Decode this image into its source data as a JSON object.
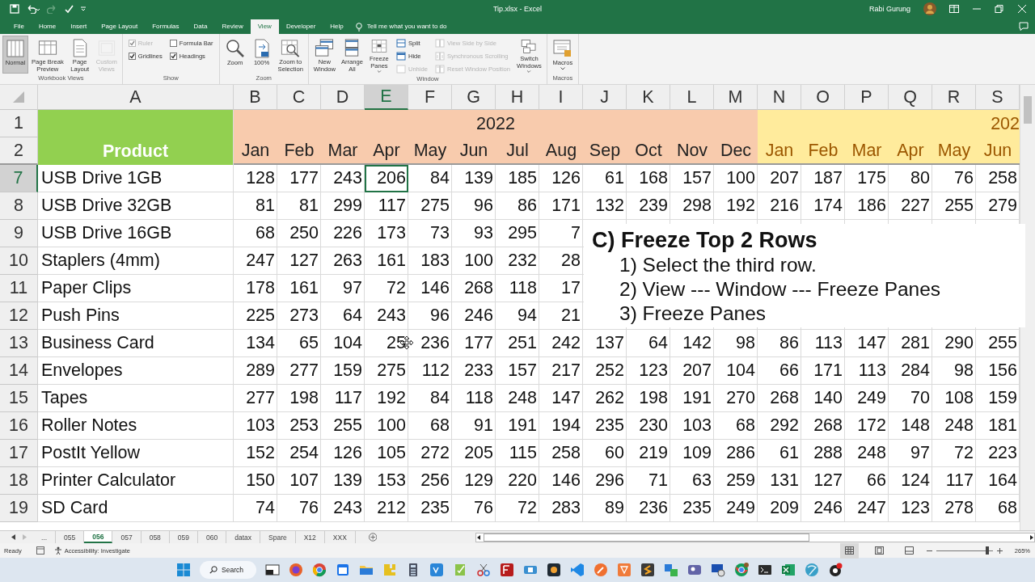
{
  "title_bar": {
    "title": "Tip.xlsx  -  Excel",
    "user": "Rabi Gurung"
  },
  "ribbon_tabs": [
    {
      "label": "File",
      "selected": false
    },
    {
      "label": "Home",
      "selected": false
    },
    {
      "label": "Insert",
      "selected": false
    },
    {
      "label": "Page Layout",
      "selected": false
    },
    {
      "label": "Formulas",
      "selected": false
    },
    {
      "label": "Data",
      "selected": false
    },
    {
      "label": "Review",
      "selected": false
    },
    {
      "label": "View",
      "selected": true
    },
    {
      "label": "Developer",
      "selected": false
    },
    {
      "label": "Help",
      "selected": false
    }
  ],
  "tell_me": "Tell me what you want to do",
  "ribbon_groups": [
    {
      "name": "Workbook Views",
      "items": [
        {
          "kind": "large",
          "label": "Normal",
          "selected": true,
          "disabled": false
        },
        {
          "kind": "large",
          "label": "Page Break\nPreview",
          "selected": false,
          "disabled": false
        },
        {
          "kind": "large",
          "label": "Page\nLayout",
          "selected": false,
          "disabled": false
        },
        {
          "kind": "large",
          "label": "Custom\nViews",
          "selected": false,
          "disabled": true
        }
      ]
    },
    {
      "name": "Show",
      "items": [
        {
          "kind": "stack",
          "items": [
            {
              "kind": "check",
              "label": "Ruler",
              "checked": true,
              "disabled": true
            },
            {
              "kind": "check",
              "label": "Gridlines",
              "checked": true,
              "disabled": false
            }
          ]
        },
        {
          "kind": "stack",
          "items": [
            {
              "kind": "check",
              "label": "Formula Bar",
              "checked": false,
              "disabled": false
            },
            {
              "kind": "check",
              "label": "Headings",
              "checked": true,
              "disabled": false
            }
          ]
        }
      ]
    },
    {
      "name": "Zoom",
      "items": [
        {
          "kind": "large",
          "label": "Zoom",
          "disabled": false
        },
        {
          "kind": "large",
          "label": "100%",
          "disabled": false
        },
        {
          "kind": "large",
          "label": "Zoom to\nSelection",
          "disabled": false
        }
      ]
    },
    {
      "name": "Window",
      "items": [
        {
          "kind": "large",
          "label": "New\nWindow",
          "disabled": false
        },
        {
          "kind": "large",
          "label": "Arrange\nAll",
          "disabled": false
        },
        {
          "kind": "large",
          "label": "Freeze\nPanes",
          "dropdown": true,
          "disabled": false
        },
        {
          "kind": "stack",
          "items": [
            {
              "kind": "small",
              "label": "Split",
              "disabled": false
            },
            {
              "kind": "small",
              "label": "Hide",
              "disabled": false
            },
            {
              "kind": "small",
              "label": "Unhide",
              "disabled": true
            }
          ]
        },
        {
          "kind": "stack",
          "items": [
            {
              "kind": "small",
              "label": "View Side by Side",
              "disabled": true
            },
            {
              "kind": "small",
              "label": "Synchronous Scrolling",
              "disabled": true
            },
            {
              "kind": "small",
              "label": "Reset Window Position",
              "disabled": true
            }
          ]
        },
        {
          "kind": "large",
          "label": "Switch\nWindows",
          "dropdown": true,
          "disabled": false
        }
      ]
    },
    {
      "name": "Macros",
      "items": [
        {
          "kind": "large",
          "label": "Macros",
          "dropdown": true,
          "disabled": false
        }
      ]
    }
  ],
  "sheet": {
    "columns": [
      {
        "label": "A",
        "selected": false
      },
      {
        "label": "B",
        "selected": false
      },
      {
        "label": "C",
        "selected": false
      },
      {
        "label": "D",
        "selected": false
      },
      {
        "label": "E",
        "selected": true
      },
      {
        "label": "F",
        "selected": false
      },
      {
        "label": "G",
        "selected": false
      },
      {
        "label": "H",
        "selected": false
      },
      {
        "label": "I",
        "selected": false
      },
      {
        "label": "J",
        "selected": false
      },
      {
        "label": "K",
        "selected": false
      },
      {
        "label": "L",
        "selected": false
      },
      {
        "label": "M",
        "selected": false
      },
      {
        "label": "N",
        "selected": false
      },
      {
        "label": "O",
        "selected": false
      },
      {
        "label": "P",
        "selected": false
      },
      {
        "label": "Q",
        "selected": false
      },
      {
        "label": "R",
        "selected": false
      },
      {
        "label": "S",
        "selected": false
      }
    ],
    "header_row_numbers": [
      "1",
      "2"
    ],
    "product_header": {
      "label": "Product",
      "color": "#92d050"
    },
    "year_bands": [
      {
        "year": "2022",
        "color": "#f8cbad",
        "months": [
          "Jan",
          "Feb",
          "Mar",
          "Apr",
          "May",
          "Jun",
          "Jul",
          "Aug",
          "Sep",
          "Oct",
          "Nov",
          "Dec"
        ]
      },
      {
        "year": "202",
        "color": "#ffeb9c",
        "months": [
          "Jan",
          "Feb",
          "Mar",
          "Apr",
          "May",
          "Jun"
        ]
      }
    ],
    "rows": [
      {
        "number": "7",
        "selected": true,
        "cells": [
          "USB Drive 1GB",
          "128",
          "177",
          "243",
          "206",
          "84",
          "139",
          "185",
          "126",
          "61",
          "168",
          "157",
          "100",
          "207",
          "187",
          "175",
          "80",
          "76",
          "258"
        ]
      },
      {
        "number": "8",
        "selected": false,
        "cells": [
          "USB Drive 32GB",
          "81",
          "81",
          "299",
          "117",
          "275",
          "96",
          "86",
          "171",
          "132",
          "239",
          "298",
          "192",
          "216",
          "174",
          "186",
          "227",
          "255",
          "279"
        ]
      },
      {
        "number": "9",
        "selected": false,
        "cells": [
          "USB Drive 16GB",
          "68",
          "250",
          "226",
          "173",
          "73",
          "93",
          "295",
          "7"
        ]
      },
      {
        "number": "10",
        "selected": false,
        "cells": [
          "Staplers (4mm)",
          "247",
          "127",
          "263",
          "161",
          "183",
          "100",
          "232",
          "28"
        ]
      },
      {
        "number": "11",
        "selected": false,
        "cells": [
          "Paper Clips",
          "178",
          "161",
          "97",
          "72",
          "146",
          "268",
          "118",
          "17"
        ]
      },
      {
        "number": "12",
        "selected": false,
        "cells": [
          "Push Pins",
          "225",
          "273",
          "64",
          "243",
          "96",
          "246",
          "94",
          "21"
        ]
      },
      {
        "number": "13",
        "selected": false,
        "cells": [
          "Business Card",
          "134",
          "65",
          "104",
          "25",
          "236",
          "177",
          "251",
          "242",
          "137",
          "64",
          "142",
          "98",
          "86",
          "113",
          "147",
          "281",
          "290",
          "255"
        ]
      },
      {
        "number": "14",
        "selected": false,
        "cells": [
          "Envelopes",
          "289",
          "277",
          "159",
          "275",
          "112",
          "233",
          "157",
          "217",
          "252",
          "123",
          "207",
          "104",
          "66",
          "171",
          "113",
          "284",
          "98",
          "156"
        ]
      },
      {
        "number": "15",
        "selected": false,
        "cells": [
          "Tapes",
          "277",
          "198",
          "117",
          "192",
          "84",
          "118",
          "248",
          "147",
          "262",
          "198",
          "191",
          "270",
          "268",
          "140",
          "249",
          "70",
          "108",
          "159"
        ]
      },
      {
        "number": "16",
        "selected": false,
        "cells": [
          "Roller Notes",
          "103",
          "253",
          "255",
          "100",
          "68",
          "91",
          "191",
          "194",
          "235",
          "230",
          "103",
          "68",
          "292",
          "268",
          "172",
          "148",
          "248",
          "181"
        ]
      },
      {
        "number": "17",
        "selected": false,
        "cells": [
          "PostIt Yellow",
          "152",
          "254",
          "126",
          "105",
          "272",
          "205",
          "115",
          "258",
          "60",
          "219",
          "109",
          "286",
          "61",
          "288",
          "248",
          "97",
          "72",
          "223"
        ]
      },
      {
        "number": "18",
        "selected": false,
        "cells": [
          "Printer Calculator",
          "150",
          "107",
          "139",
          "153",
          "256",
          "129",
          "220",
          "146",
          "296",
          "71",
          "63",
          "259",
          "131",
          "127",
          "66",
          "124",
          "117",
          "164"
        ]
      },
      {
        "number": "19",
        "selected": false,
        "cells": [
          "SD Card",
          "74",
          "76",
          "243",
          "212",
          "235",
          "76",
          "72",
          "283",
          "89",
          "236",
          "235",
          "249",
          "209",
          "246",
          "247",
          "123",
          "278",
          "68"
        ]
      }
    ]
  },
  "note": {
    "title": "C) Freeze Top 2 Rows",
    "steps": [
      "1) Select the third row.",
      "2) View --- Window --- Freeze Panes",
      "3) Freeze Panes"
    ]
  },
  "sheet_tabs": {
    "more": "...",
    "tabs": [
      {
        "label": "055",
        "selected": false
      },
      {
        "label": "056",
        "selected": true
      },
      {
        "label": "057",
        "selected": false
      },
      {
        "label": "058",
        "selected": false
      },
      {
        "label": "059",
        "selected": false
      },
      {
        "label": "060",
        "selected": false
      },
      {
        "label": "datax",
        "selected": false
      },
      {
        "label": "Spare",
        "selected": false
      },
      {
        "label": "X12",
        "selected": false
      },
      {
        "label": "XXX",
        "selected": false
      }
    ]
  },
  "status_bar": {
    "status": "Ready",
    "accessibility": "Accessibility: Investigate",
    "zoom": {
      "level": 0.9,
      "reading": "265%"
    }
  },
  "taskbar": {
    "search": "Search"
  }
}
